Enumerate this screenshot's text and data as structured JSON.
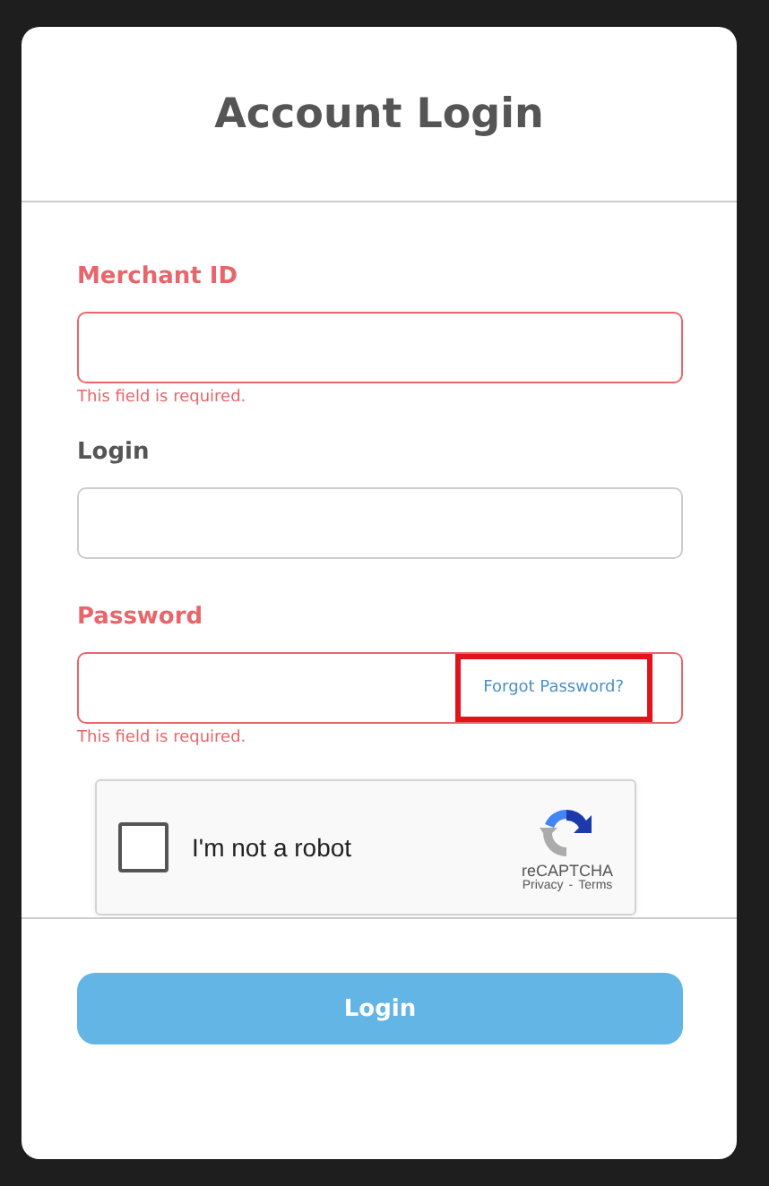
{
  "title": "Account Login",
  "fields": [
    {
      "label": "Merchant ID",
      "invalid": true,
      "error": "This field is required."
    },
    {
      "label": "Login",
      "invalid": false
    },
    {
      "label": "Password",
      "invalid": true,
      "error": "This field is required.",
      "link": {
        "label": "Forgot Password?",
        "highlighted": true
      }
    }
  ],
  "captcha": {
    "label": "I'm not a robot",
    "checked": false,
    "brand": "reCAPTCHA",
    "privacy": "Privacy",
    "separator": "-",
    "terms": "Terms"
  },
  "submit": "Login"
}
